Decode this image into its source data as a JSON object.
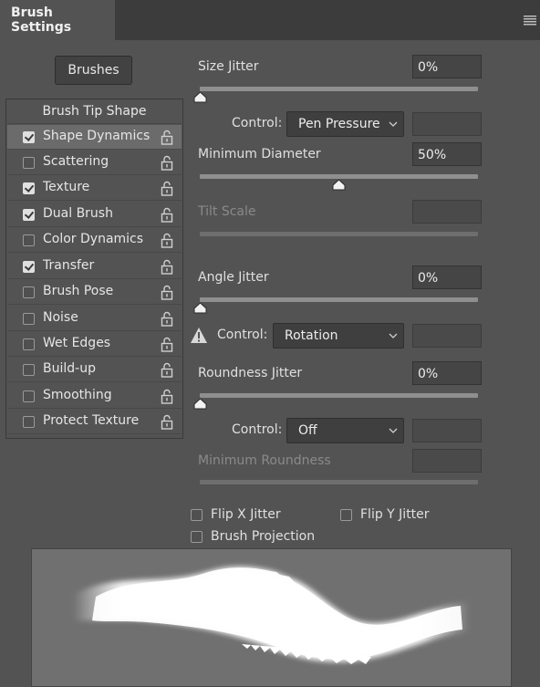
{
  "panel": {
    "tab_title": "Brush Settings",
    "menu_icon": "hamburger-menu-icon"
  },
  "brushes_button": "Brushes",
  "left_list": {
    "header": "Brush Tip Shape",
    "items": [
      {
        "label": "Shape Dynamics",
        "checked": true
      },
      {
        "label": "Scattering",
        "checked": false
      },
      {
        "label": "Texture",
        "checked": true
      },
      {
        "label": "Dual Brush",
        "checked": true
      },
      {
        "label": "Color Dynamics",
        "checked": false
      },
      {
        "label": "Transfer",
        "checked": true
      },
      {
        "label": "Brush Pose",
        "checked": false
      },
      {
        "label": "Noise",
        "checked": false
      },
      {
        "label": "Wet Edges",
        "checked": false
      },
      {
        "label": "Build-up",
        "checked": false
      },
      {
        "label": "Smoothing",
        "checked": false
      },
      {
        "label": "Protect Texture",
        "checked": false
      }
    ],
    "selected": "Shape Dynamics",
    "lock_icon": "lock-open-icon"
  },
  "size_jitter": {
    "label": "Size Jitter",
    "value": "0%",
    "control_label": "Control:",
    "control_value": "Pen Pressure"
  },
  "minimum_diameter": {
    "label": "Minimum Diameter",
    "value": "50%"
  },
  "tilt_scale": {
    "label": "Tilt Scale",
    "value": ""
  },
  "angle_jitter": {
    "label": "Angle Jitter",
    "value": "0%",
    "control_label": "Control:",
    "control_value": "Rotation",
    "warning_icon": "warning-icon"
  },
  "roundness_jitter": {
    "label": "Roundness Jitter",
    "value": "0%",
    "control_label": "Control:",
    "control_value": "Off"
  },
  "minimum_roundness": {
    "label": "Minimum Roundness",
    "value": ""
  },
  "flip_x": {
    "label": "Flip X Jitter",
    "checked": false
  },
  "flip_y": {
    "label": "Flip Y Jitter",
    "checked": false
  },
  "brush_projection": {
    "label": "Brush Projection",
    "checked": false
  },
  "colors": {
    "panel_bg": "#535353",
    "tab_bar_bg": "#3c3c3c",
    "selected_row_bg": "#6b6b6b",
    "field_bg": "#454545",
    "preview_bg": "#707070"
  }
}
